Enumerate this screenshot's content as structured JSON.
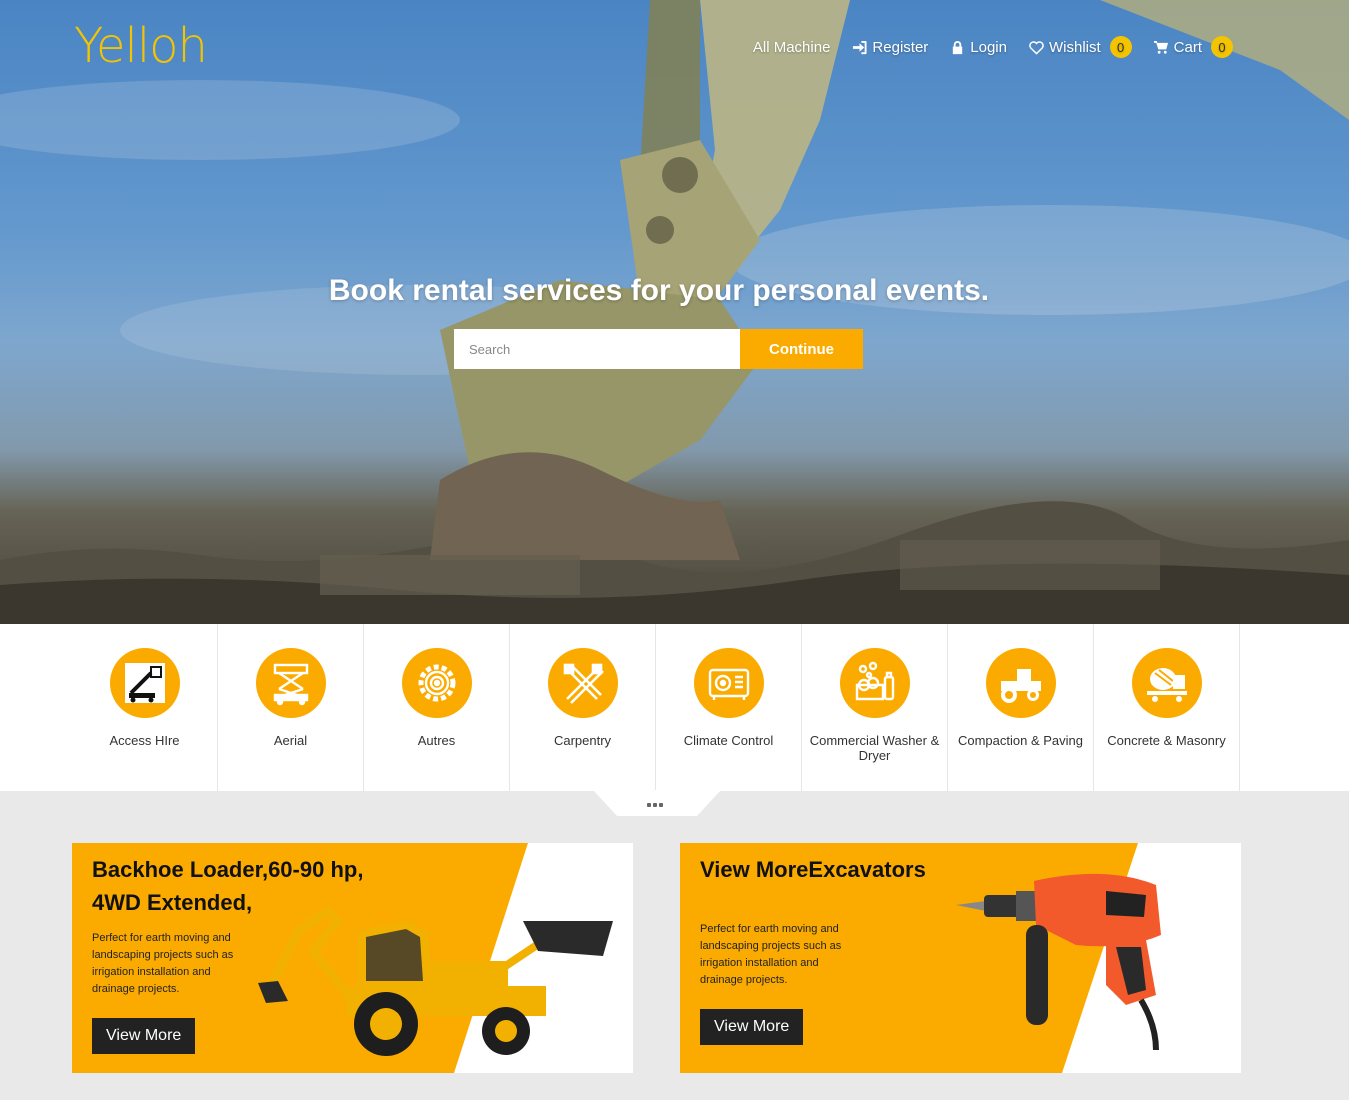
{
  "brand": {
    "logo": "Yelloh",
    "accent": "#fbab00",
    "logo_color": "#f5c400"
  },
  "nav": {
    "all_machine": "All Machine",
    "register": "Register",
    "login": "Login",
    "wishlist": "Wishlist",
    "wishlist_count": "0",
    "cart": "Cart",
    "cart_count": "0"
  },
  "hero": {
    "title": "Book rental services for your personal events.",
    "search_placeholder": "Search",
    "continue_label": "Continue"
  },
  "categories": [
    {
      "label": "Access HIre",
      "icon": "access-hire-icon"
    },
    {
      "label": "Aerial",
      "icon": "aerial-lift-icon"
    },
    {
      "label": "Autres",
      "icon": "gear-icon"
    },
    {
      "label": "Carpentry",
      "icon": "carpentry-tools-icon"
    },
    {
      "label": "Climate Control",
      "icon": "air-conditioner-icon"
    },
    {
      "label": "Commercial Washer & Dryer",
      "icon": "washer-icon"
    },
    {
      "label": "Compaction & Paving",
      "icon": "road-roller-icon"
    },
    {
      "label": "Concrete & Masonry",
      "icon": "concrete-mixer-icon"
    }
  ],
  "promos": [
    {
      "title_line1": "Backhoe Loader,60-90 hp,",
      "title_line2": "4WD Extended,",
      "text": "Perfect for earth moving and landscaping projects such as irrigation installation and drainage projects.",
      "button": "View More",
      "image": "backhoe-loader-image"
    },
    {
      "title_line1": "View MoreExcavators",
      "text": "Perfect for earth moving and landscaping projects such as irrigation installation and drainage projects.",
      "button": "View More",
      "image": "power-drill-image"
    }
  ]
}
